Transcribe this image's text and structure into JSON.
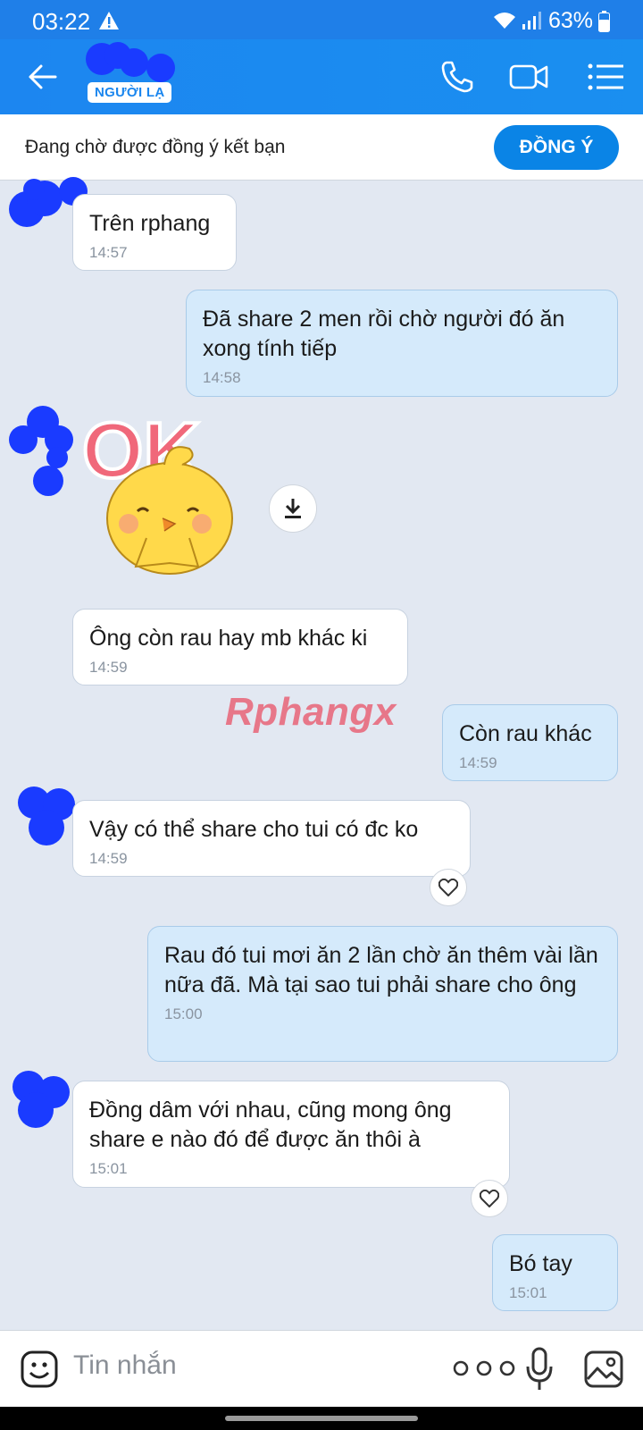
{
  "status": {
    "time": "03:22",
    "battery": "63%"
  },
  "header": {
    "badge": "NGƯỜI LẠ"
  },
  "request": {
    "text": "Đang chờ được đồng ý kết bạn",
    "button": "ĐỒNG Ý"
  },
  "messages": [
    {
      "side": "in",
      "text": "Trên rphang",
      "time": "14:57"
    },
    {
      "side": "out",
      "text": "Đã share 2 men rồi chờ người đó ăn xong tính tiếp",
      "time": "14:58"
    },
    {
      "side": "in",
      "text": "Ông còn rau hay mb khác ki",
      "time": "14:59"
    },
    {
      "side": "out",
      "text": "Còn rau khác",
      "time": "14:59"
    },
    {
      "side": "in",
      "text": "Vậy có thể share cho tui có đc ko",
      "time": "14:59"
    },
    {
      "side": "out",
      "text": "Rau đó tui mơi ăn 2 lần chờ ăn thêm vài lần nữa đã. Mà tại sao tui phải share cho ông",
      "time": "15:00"
    },
    {
      "side": "in",
      "text": "Đồng dâm với nhau, cũng mong ông share e nào đó để được ăn thôi à",
      "time": "15:01"
    },
    {
      "side": "out",
      "text": "Bó tay",
      "time": "15:01"
    }
  ],
  "sticker": {
    "name": "ok-chick-sticker",
    "text": "OK"
  },
  "watermark": "Rphangx",
  "input": {
    "placeholder": "Tin nhắn"
  },
  "colors": {
    "header": "#1c86f0",
    "outgoing_bubble": "#d5eafb",
    "incoming_bubble": "#ffffff",
    "background": "#e2e8f2",
    "accept_button": "#0a84e6"
  }
}
